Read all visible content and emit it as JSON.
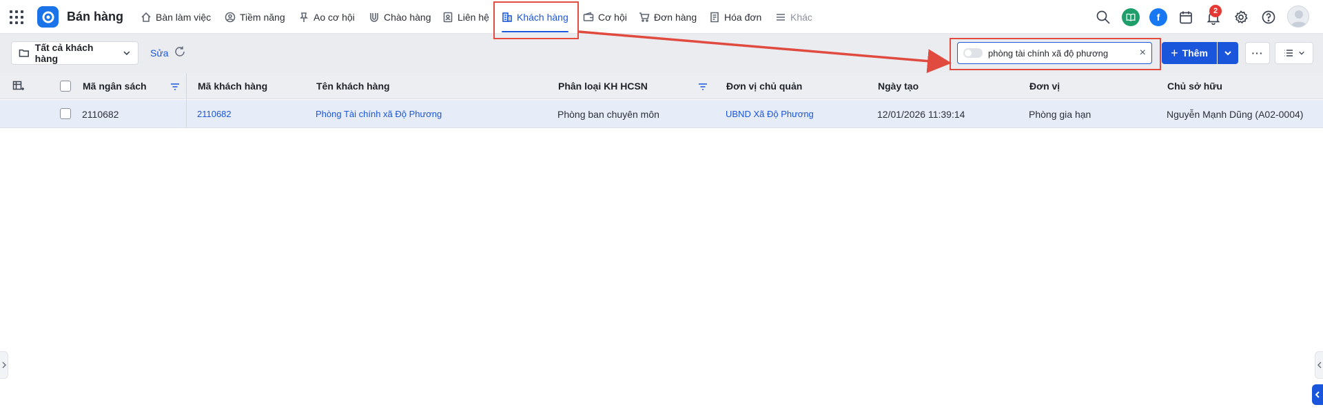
{
  "app": {
    "title": "Bán hàng"
  },
  "nav": {
    "items": [
      {
        "label": "Bàn làm việc",
        "icon": "home-icon"
      },
      {
        "label": "Tiềm năng",
        "icon": "user-circle-icon"
      },
      {
        "label": "Ao cơ hội",
        "icon": "pin-icon"
      },
      {
        "label": "Chào hàng",
        "icon": "magnet-icon"
      },
      {
        "label": "Liên hệ",
        "icon": "contact-icon"
      },
      {
        "label": "Khách hàng",
        "icon": "building-icon",
        "active": true
      },
      {
        "label": "Cơ hội",
        "icon": "wallet-icon"
      },
      {
        "label": "Đơn hàng",
        "icon": "cart-icon"
      },
      {
        "label": "Hóa đơn",
        "icon": "invoice-icon"
      },
      {
        "label": "Khác",
        "icon": "menu-icon"
      }
    ]
  },
  "top_icons": {
    "notification_count": "2",
    "facebook_letter": "f"
  },
  "toolbar": {
    "view_label": "Tất cả khách hàng",
    "edit_label": "Sửa",
    "search_value": "phòng tài chính xã độ phương",
    "clear_symbol": "×",
    "add_label": "Thêm",
    "more_label": "···"
  },
  "table": {
    "columns": [
      "Mã ngân sách",
      "Mã khách hàng",
      "Tên khách hàng",
      "Phân loại KH HCSN",
      "Đơn vị chủ quản",
      "Ngày tạo",
      "Đơn vị",
      "Chủ sở hữu"
    ],
    "rows": [
      {
        "ma_ngan_sach": "2110682",
        "ma_khach_hang": "2110682",
        "ten_khach_hang": "Phòng Tài chính xã Độ Phương",
        "phan_loai": "Phòng ban chuyên môn",
        "don_vi_chu_quan": "UBND Xã Độ Phương",
        "ngay_tao": "12/01/2026 11:39:14",
        "don_vi": "Phòng gia hạn",
        "chu_so_huu": "Nguyễn Mạnh Dũng (A02-0004)"
      }
    ]
  },
  "colors": {
    "accent": "#1a56db",
    "annotation": "#e04a3f",
    "selected_row": "#e7ecf9"
  }
}
